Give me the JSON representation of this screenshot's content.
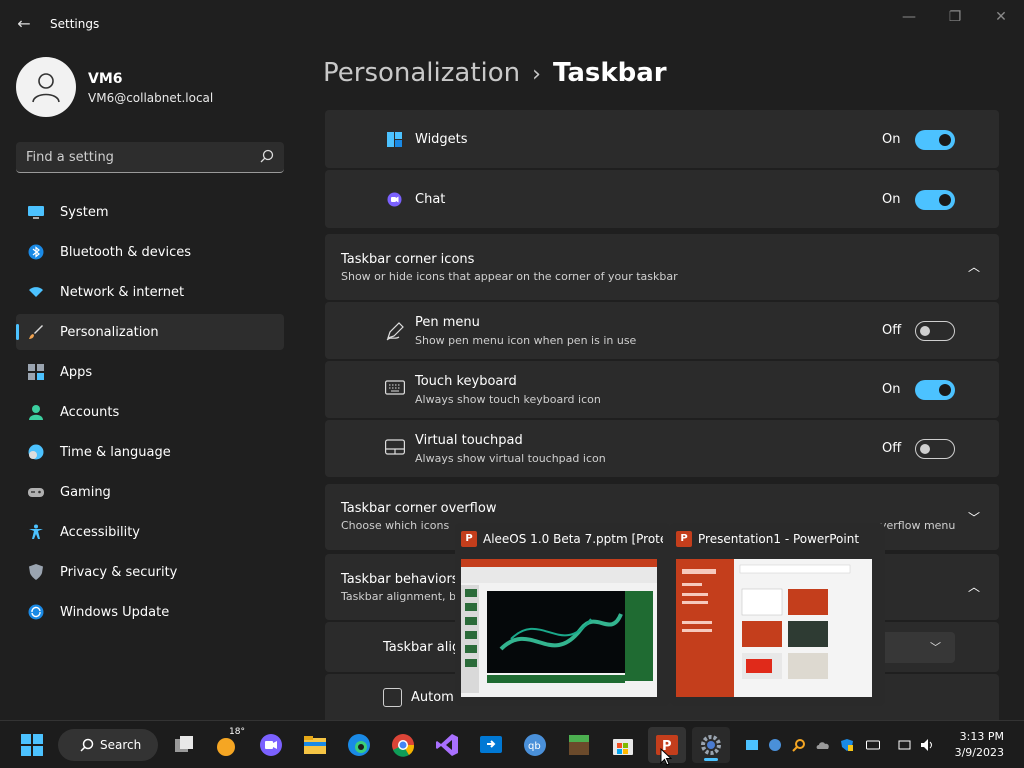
{
  "window": {
    "title": "Settings",
    "back_glyph": "←",
    "minimize_glyph": "—",
    "maximize_glyph": "❐",
    "close_glyph": "✕"
  },
  "user": {
    "name": "VM6",
    "email": "VM6@collabnet.local"
  },
  "search": {
    "placeholder": "Find a setting"
  },
  "sidebar": {
    "items": [
      {
        "label": "System",
        "icon": "monitor-icon",
        "color": "#4cc2ff",
        "selected": false
      },
      {
        "label": "Bluetooth & devices",
        "icon": "bluetooth-icon",
        "color": "#1a8ae6",
        "selected": false
      },
      {
        "label": "Network & internet",
        "icon": "wifi-icon",
        "color": "#4cc2ff",
        "selected": false
      },
      {
        "label": "Personalization",
        "icon": "brush-icon",
        "color": "#f0a250",
        "selected": true
      },
      {
        "label": "Apps",
        "icon": "apps-icon",
        "color": "#9aa4b0",
        "selected": false
      },
      {
        "label": "Accounts",
        "icon": "person-icon",
        "color": "#3ccfa0",
        "selected": false
      },
      {
        "label": "Time & language",
        "icon": "clock-globe-icon",
        "color": "#4cc2ff",
        "selected": false
      },
      {
        "label": "Gaming",
        "icon": "gamepad-icon",
        "color": "#b0b0b0",
        "selected": false
      },
      {
        "label": "Accessibility",
        "icon": "accessibility-icon",
        "color": "#4cc2ff",
        "selected": false
      },
      {
        "label": "Privacy & security",
        "icon": "shield-icon",
        "color": "#9aa4b0",
        "selected": false
      },
      {
        "label": "Windows Update",
        "icon": "update-icon",
        "color": "#1a8ae6",
        "selected": false
      }
    ]
  },
  "header": {
    "parent": "Personalization",
    "separator": "›",
    "current": "Taskbar"
  },
  "content": {
    "widgets": {
      "label": "Widgets",
      "state": "On",
      "on": true
    },
    "chat": {
      "label": "Chat",
      "state": "On",
      "on": true
    },
    "corner_icons": {
      "title": "Taskbar corner icons",
      "subtitle": "Show or hide icons that appear on the corner of your taskbar",
      "chevron": "︿"
    },
    "pen_menu": {
      "label": "Pen menu",
      "subtitle": "Show pen menu icon when pen is in use",
      "state": "Off",
      "on": false
    },
    "touch_keyboard": {
      "label": "Touch keyboard",
      "subtitle": "Always show touch keyboard icon",
      "state": "On",
      "on": true
    },
    "virtual_touchpad": {
      "label": "Virtual touchpad",
      "subtitle": "Always show virtual touchpad icon",
      "state": "Off",
      "on": false
    },
    "corner_overflow": {
      "title": "Taskbar corner overflow",
      "subtitle_left": "Choose which icons",
      "subtitle_right": "verflow menu",
      "chevron": "﹀"
    },
    "behaviors": {
      "title": "Taskbar behaviors",
      "subtitle": "Taskbar alignment, b",
      "chevron": "︿"
    },
    "alignment": {
      "label": "Taskbar alig"
    },
    "auto_hide": {
      "label": "Autom"
    }
  },
  "previews": [
    {
      "title": "AleeOS 1.0 Beta 7.pptm [Prote...",
      "icon": "powerpoint-icon",
      "badge": "P"
    },
    {
      "title": "Presentation1 - PowerPoint",
      "icon": "powerpoint-icon",
      "badge": "P"
    }
  ],
  "taskbar": {
    "search_label": "Search",
    "weather": "18°",
    "time": "3:13 PM",
    "date": "3/9/2023"
  }
}
